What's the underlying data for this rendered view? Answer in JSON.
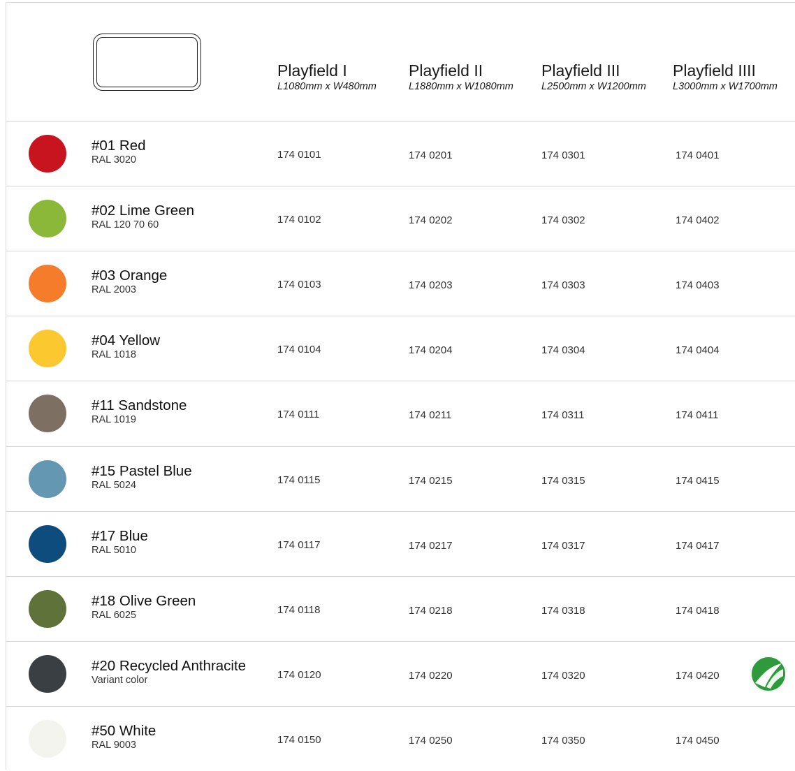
{
  "header": {
    "columns": [
      {
        "name": "Playfield I",
        "dims": "L1080mm x W480mm"
      },
      {
        "name": "Playfield II",
        "dims": "L1880mm x W1080mm"
      },
      {
        "name": "Playfield III",
        "dims": "L2500mm x W1200mm"
      },
      {
        "name": "Playfield IIII",
        "dims": "L3000mm x W1700mm"
      }
    ]
  },
  "rows": [
    {
      "title": "#01 Red",
      "sub": "RAL 3020",
      "color": "#c8141f",
      "codes": [
        "174 0101",
        "174 0201",
        "174 0301",
        "174 0401"
      ]
    },
    {
      "title": "#02 Lime Green",
      "sub": "RAL 120 70 60",
      "color": "#8cb83a",
      "codes": [
        "174 0102",
        "174 0202",
        "174 0302",
        "174 0402"
      ]
    },
    {
      "title": "#03 Orange",
      "sub": "RAL 2003",
      "color": "#f47c2b",
      "codes": [
        "174 0103",
        "174 0203",
        "174 0303",
        "174 0403"
      ]
    },
    {
      "title": "#04 Yellow",
      "sub": "RAL 1018",
      "color": "#fbc92f",
      "codes": [
        "174 0104",
        "174 0204",
        "174 0304",
        "174 0404"
      ]
    },
    {
      "title": "#11 Sandstone",
      "sub": "RAL 1019",
      "color": "#7d7063",
      "codes": [
        "174 0111",
        "174 0211",
        "174 0311",
        "174 0411"
      ]
    },
    {
      "title": "#15 Pastel Blue",
      "sub": "RAL 5024",
      "color": "#6497b1",
      "codes": [
        "174 0115",
        "174 0215",
        "174 0315",
        "174 0415"
      ]
    },
    {
      "title": "#17 Blue",
      "sub": "RAL 5010",
      "color": "#0d4c7c",
      "codes": [
        "174 0117",
        "174 0217",
        "174 0317",
        "174 0417"
      ]
    },
    {
      "title": "#18 Olive Green",
      "sub": "RAL 6025",
      "color": "#5e7239",
      "codes": [
        "174 0118",
        "174 0218",
        "174 0318",
        "174 0418"
      ]
    },
    {
      "title": "#20 Recycled Anthracite",
      "sub": "Variant color",
      "color": "#3a3f44",
      "codes": [
        "174 0120",
        "174 0220",
        "174 0320",
        "174 0420"
      ],
      "badge": "nordic-swan-ecolabel-icon"
    },
    {
      "title": "#50 White",
      "sub": "RAL 9003",
      "color": "#f4f4ef",
      "codes": [
        "174 0150",
        "174 0250",
        "174 0350",
        "174 0450"
      ]
    }
  ]
}
